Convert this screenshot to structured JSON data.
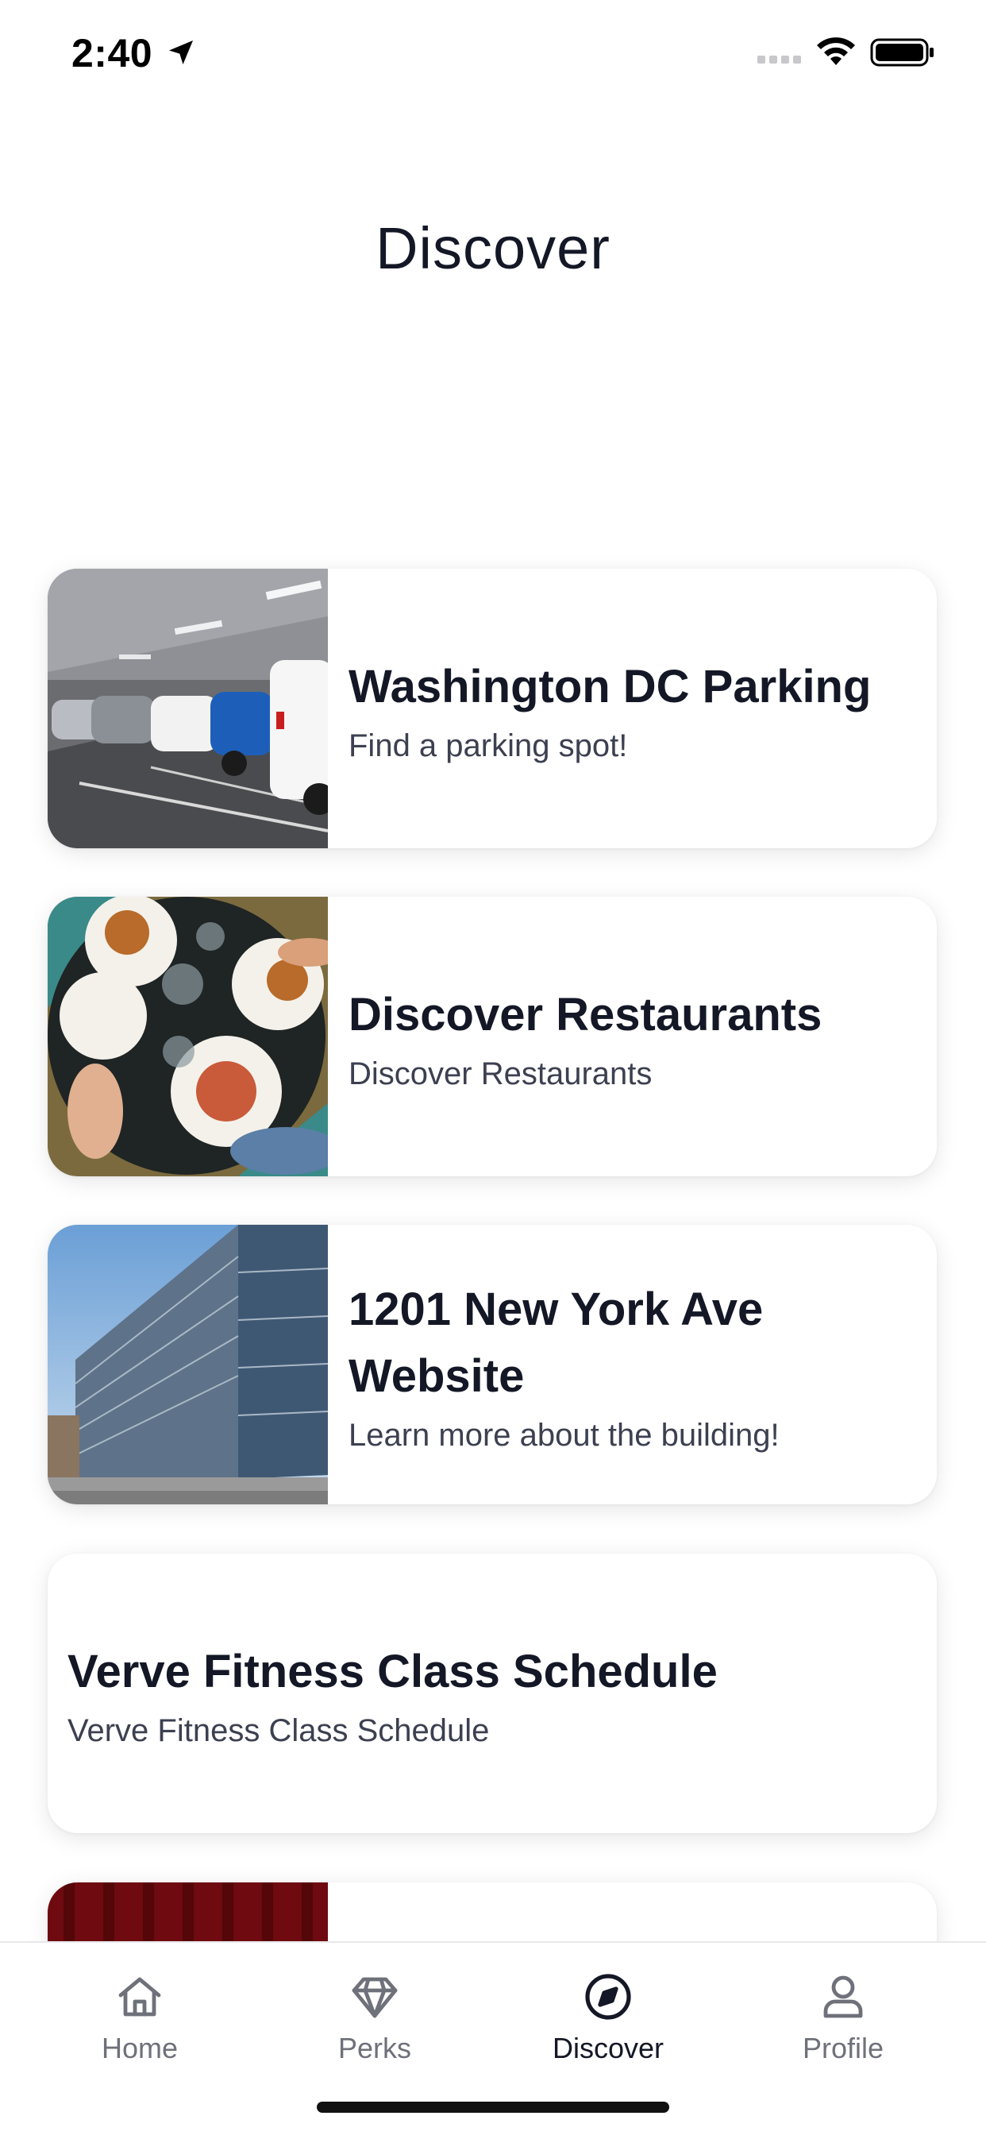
{
  "status_bar": {
    "time": "2:40",
    "icons": [
      "location-arrow-icon",
      "cellular-signal-icon",
      "wifi-icon",
      "battery-icon"
    ]
  },
  "page": {
    "title": "Discover"
  },
  "cards": [
    {
      "title": "Washington DC Parking",
      "subtitle": "Find a parking spot!",
      "image": "parking-garage-photo"
    },
    {
      "title": "Discover Restaurants",
      "subtitle": "Discover Restaurants",
      "image": "restaurant-table-photo"
    },
    {
      "title": "1201 New York Ave Website",
      "subtitle": "Learn more about the building!",
      "image": "office-building-photo"
    },
    {
      "title": "Verve Fitness Class Schedule",
      "subtitle": "Verve Fitness Class Schedule",
      "image": null
    },
    {
      "title": "",
      "subtitle": "",
      "image": "red-curtain-photo"
    }
  ],
  "tab_bar": {
    "tabs": [
      {
        "label": "Home",
        "icon": "home-icon",
        "active": false
      },
      {
        "label": "Perks",
        "icon": "diamond-icon",
        "active": false
      },
      {
        "label": "Discover",
        "icon": "compass-icon",
        "active": true
      },
      {
        "label": "Profile",
        "icon": "person-icon",
        "active": false
      }
    ]
  },
  "colors": {
    "text_primary": "#141826",
    "text_secondary": "#3c4050",
    "tab_inactive": "#6f717a",
    "background": "#ffffff"
  }
}
